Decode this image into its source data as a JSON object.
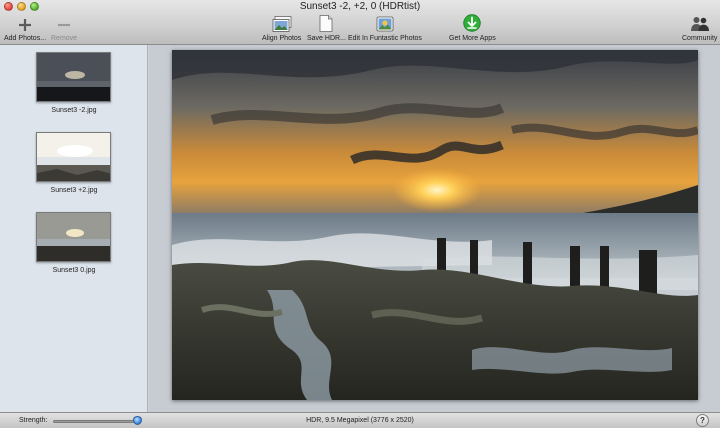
{
  "window": {
    "title": "Sunset3 -2, +2, 0 (HDRtist)"
  },
  "toolbar": {
    "add_photos": "Add Photos...",
    "remove": "Remove",
    "align_photos": "Align Photos",
    "save_hdr": "Save HDR...",
    "edit_in_fun": "Edit In Funtastic Photos",
    "get_more_apps": "Get More Apps",
    "community": "Community"
  },
  "sidebar": {
    "items": [
      {
        "label": "Sunset3 -2.jpg"
      },
      {
        "label": "Sunset3 +2.jpg"
      },
      {
        "label": "Sunset3 0.jpg"
      }
    ]
  },
  "status": {
    "strength_label": "Strength:",
    "strength_value": 0.98,
    "info": "HDR, 9.5 Megapixel (3776 x 2520)",
    "help": "?"
  },
  "colors": {
    "accent": "#2f7ed8",
    "get_apps": "#2fae3a"
  }
}
